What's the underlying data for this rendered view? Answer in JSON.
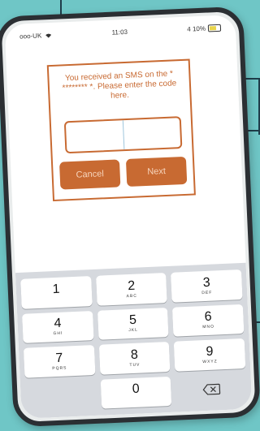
{
  "status_bar": {
    "carrier": "ooo-UK",
    "time": "11:03",
    "battery_text": "4 10%"
  },
  "dialog": {
    "message": "You received an SMS on the * ******** *. Please enter the code here.",
    "cancel_label": "Cancel",
    "next_label": "Next"
  },
  "keypad": {
    "keys": [
      {
        "digit": "1",
        "letters": ""
      },
      {
        "digit": "2",
        "letters": "ABC"
      },
      {
        "digit": "3",
        "letters": "DEF"
      },
      {
        "digit": "4",
        "letters": "GHI"
      },
      {
        "digit": "5",
        "letters": "JKL"
      },
      {
        "digit": "6",
        "letters": "MNO"
      },
      {
        "digit": "7",
        "letters": "PQRS"
      },
      {
        "digit": "8",
        "letters": "TUV"
      },
      {
        "digit": "9",
        "letters": "WXYZ"
      },
      {
        "digit": "0",
        "letters": ""
      }
    ],
    "delete_icon": "backspace-icon"
  },
  "colors": {
    "accent": "#c86a32",
    "background": "#6fc6c6",
    "phone_frame": "#2b2f33"
  }
}
